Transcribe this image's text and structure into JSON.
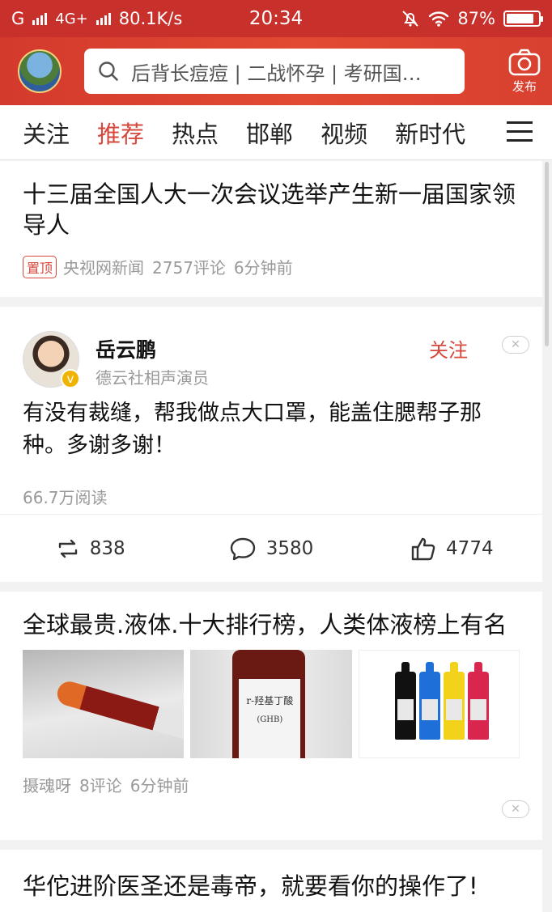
{
  "status_bar": {
    "carrier_left": "G",
    "network": "4G+",
    "speed": "80.1K/s",
    "time": "20:34",
    "battery": "87%",
    "battery_level": 0.87
  },
  "header": {
    "search_placeholder": "后背长痘痘 | 二战怀孕 | 考研国…",
    "publish_label": "发布"
  },
  "tabs": [
    "关注",
    "推荐",
    "热点",
    "邯郸",
    "视频",
    "新时代"
  ],
  "active_tab": 1,
  "feed": {
    "item1": {
      "title": "十三届全国人大一次会议选举产生新一届国家领导人",
      "pin": "置顶",
      "source": "央视网新闻",
      "comments": "2757评论",
      "time": "6分钟前"
    },
    "item2": {
      "author": "岳云鹏",
      "author_desc": "德云社相声演员",
      "follow": "关注",
      "text": "有没有裁缝，帮我做点大口罩，能盖住腮帮子那种。多谢多谢！",
      "reads": "66.7万阅读",
      "reposts": "838",
      "comments": "3580",
      "likes": "4774"
    },
    "item3": {
      "title": "全球最贵.液体.十大排行榜，人类体液榜上有名",
      "image2_line1": "r-羟基丁酸",
      "image2_line2": "(GHB)",
      "source": "摄魂呀",
      "comments": "8评论",
      "time": "6分钟前"
    },
    "item4": {
      "title": "华佗进阶医圣还是毒帝，就要看你的操作了!"
    }
  },
  "colors": {
    "brand_red": "#c8302b",
    "accent": "#d6473c"
  }
}
